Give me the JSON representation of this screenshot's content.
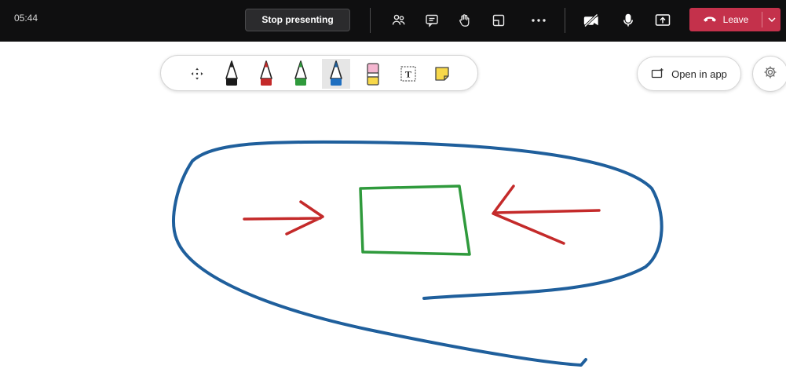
{
  "meeting_bar": {
    "timer": "05:44",
    "stop_presenting_label": "Stop presenting",
    "leave_label": "Leave",
    "icons": [
      "people-icon",
      "chat-icon",
      "raise-hand-icon",
      "rooms-icon",
      "more-icon",
      "camera-off-icon",
      "mic-icon",
      "share-icon",
      "phone-hangup-icon",
      "chevron-down-icon"
    ]
  },
  "whiteboard_toolbar": {
    "tools": [
      "move",
      "pen-black",
      "pen-red",
      "pen-green",
      "pen-blue",
      "highlighter-pink",
      "text-box",
      "sticky-note"
    ],
    "text_tool_glyph": "T",
    "active_tool": "pen-blue"
  },
  "open_in_app_label": "Open in app",
  "colors": {
    "bar_bg": "#0f0f10",
    "leave": "#c4314b",
    "ink_blue": "#1f5f9c",
    "ink_red": "#c42a2a",
    "ink_green": "#2f9a3c",
    "pen_black": "#1a1a1a",
    "highlighter_pink": "#f4b6d0",
    "sticky_yellow": "#f7d84a"
  }
}
